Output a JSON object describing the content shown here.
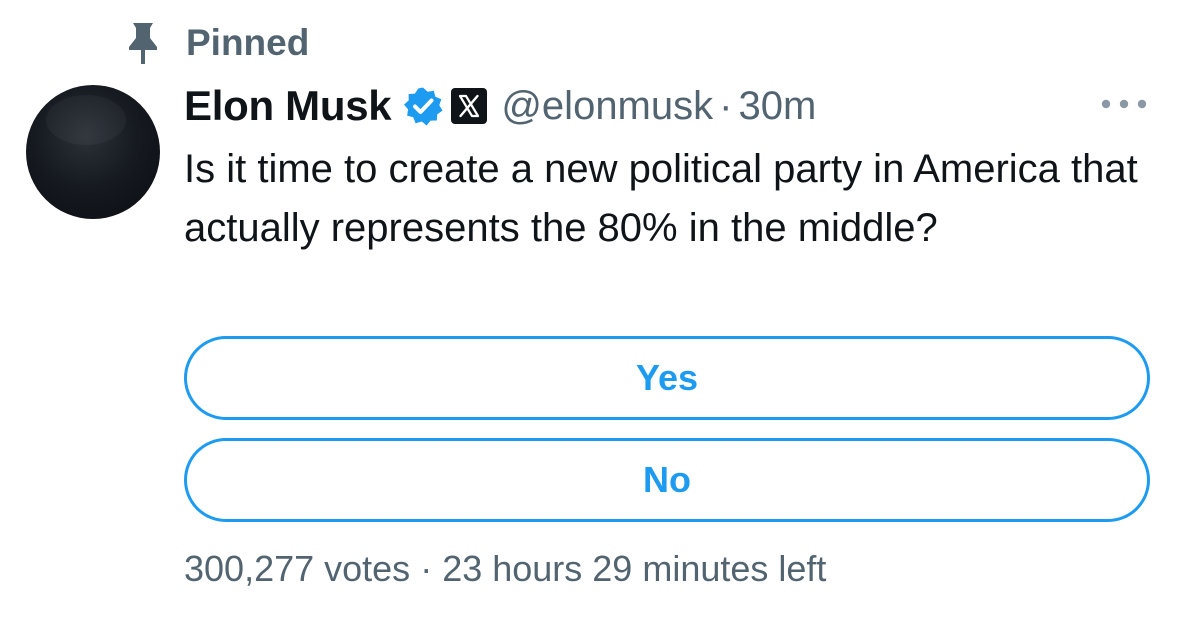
{
  "pinned": {
    "label": "Pinned",
    "icon": "pin-icon"
  },
  "author": {
    "name": "Elon Musk",
    "handle": "@elonmusk",
    "separator": "·",
    "timestamp": "30m",
    "verified_icon": "verified-badge-icon",
    "affiliate_icon": "x-logo-icon"
  },
  "more_icon": "more-horizontal-icon",
  "tweet": {
    "text": "Is it time to create a new political party in America that actually represents the 80% in the middle?"
  },
  "poll": {
    "options": [
      {
        "label": "Yes"
      },
      {
        "label": "No"
      }
    ],
    "votes": "300,277 votes",
    "separator": "·",
    "time_left": "23 hours 29 minutes left"
  },
  "colors": {
    "accent": "#1d9bf0",
    "secondary_text": "#536471",
    "primary_text": "#0f1419"
  }
}
